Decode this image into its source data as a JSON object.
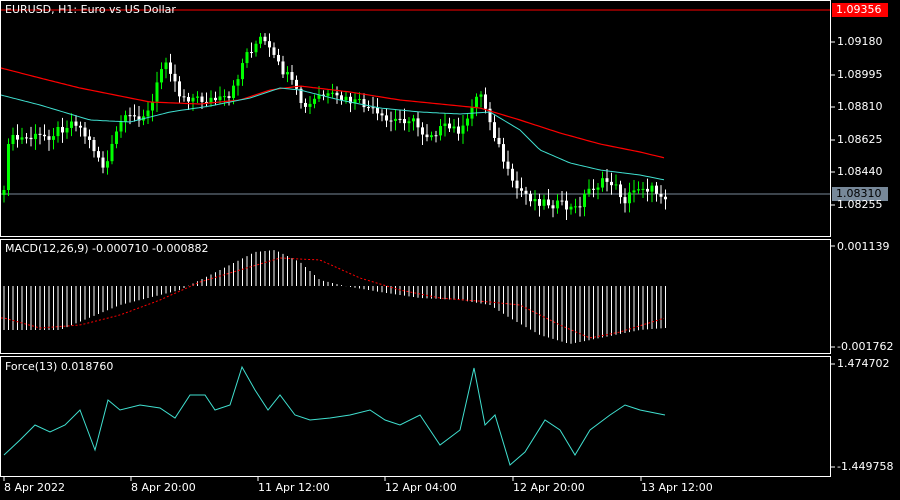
{
  "main_pane": {
    "symbol_label": "EURUSD, H1:  Euro vs US Dollar",
    "high_line_price": "1.09356",
    "high_line_color": "#ff0000",
    "current_price": "1.08310",
    "current_price_color": "#778899",
    "ma_slow_color": "#ff0000",
    "ma_fast_color": "#40e0d0",
    "candle_up_color": "#00ff00",
    "candle_down_color": "#ffffff",
    "price_axis": [
      "1.09180",
      "1.08995",
      "1.08810",
      "1.08625",
      "1.08440",
      "1.08255"
    ]
  },
  "macd_pane": {
    "label": "MACD(12,26,9) -0.000710 -0.000882",
    "axis_top": "0.001139",
    "axis_bottom": "-0.001762",
    "histogram_color": "#ffffff",
    "signal_color": "#ff0000"
  },
  "force_pane": {
    "label": "Force(13) 0.018760",
    "axis_top": "1.474702",
    "axis_bottom": "-1.449758",
    "line_color": "#40e0d0"
  },
  "time_axis": [
    "8 Apr 2022",
    "8 Apr 20:00",
    "11 Apr 12:00",
    "12 Apr 04:00",
    "12 Apr 20:00",
    "13 Apr 12:00"
  ]
}
